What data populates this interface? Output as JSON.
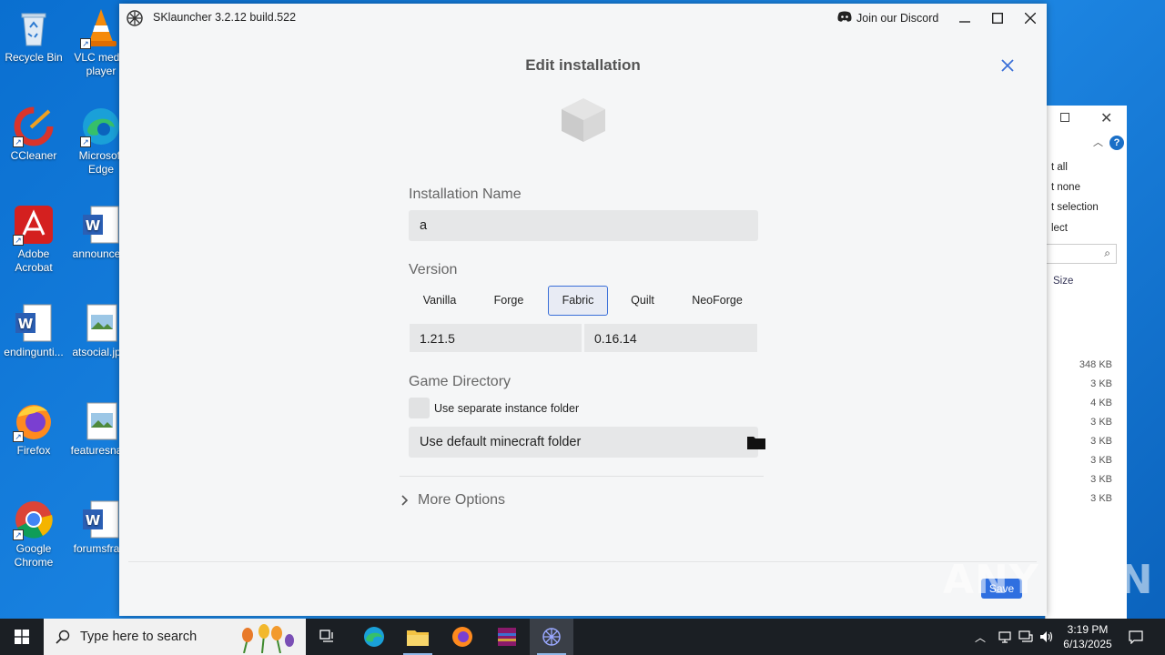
{
  "desktop": {
    "icons": [
      {
        "label": "Recycle Bin"
      },
      {
        "label": "VLC media player"
      },
      {
        "label": "CCleaner"
      },
      {
        "label": "Microsoft Edge"
      },
      {
        "label": "Adobe Acrobat"
      },
      {
        "label": "announce..."
      },
      {
        "label": "endingunti..."
      },
      {
        "label": "atsocial.jp..."
      },
      {
        "label": "Firefox"
      },
      {
        "label": "featuresna..."
      },
      {
        "label": "Google Chrome"
      },
      {
        "label": "forumsfra..."
      }
    ]
  },
  "explorer": {
    "menu": [
      "t all",
      "t none",
      "t selection",
      "lect"
    ],
    "column_size": "Size",
    "sizes": [
      "348 KB",
      "3 KB",
      "4 KB",
      "3 KB",
      "3 KB",
      "3 KB",
      "3 KB",
      "3 KB"
    ]
  },
  "launcher": {
    "title": "SKlauncher 3.2.12 build.522",
    "discord_label": "Join our Discord",
    "dialog_title": "Edit installation",
    "installation_name_label": "Installation Name",
    "installation_name_value": "a",
    "version_label": "Version",
    "loaders": [
      {
        "label": "Vanilla",
        "active": false
      },
      {
        "label": "Forge",
        "active": false
      },
      {
        "label": "Fabric",
        "active": true
      },
      {
        "label": "Quilt",
        "active": false
      },
      {
        "label": "NeoForge",
        "active": false
      }
    ],
    "game_version": "1.21.5",
    "loader_version": "0.16.14",
    "game_directory_label": "Game Directory",
    "separate_folder_label": "Use separate instance folder",
    "separate_folder_checked": false,
    "directory_value": "Use default minecraft folder",
    "more_options_label": "More Options",
    "save_label": "Save"
  },
  "watermark": "ANY RUN",
  "taskbar": {
    "search_placeholder": "Type here to search",
    "time": "3:19 PM",
    "date": "6/13/2025"
  },
  "colors": {
    "accent": "#2f6fe0",
    "active_tab_border": "#3a6fd8",
    "taskbar": "#1b1f24"
  }
}
